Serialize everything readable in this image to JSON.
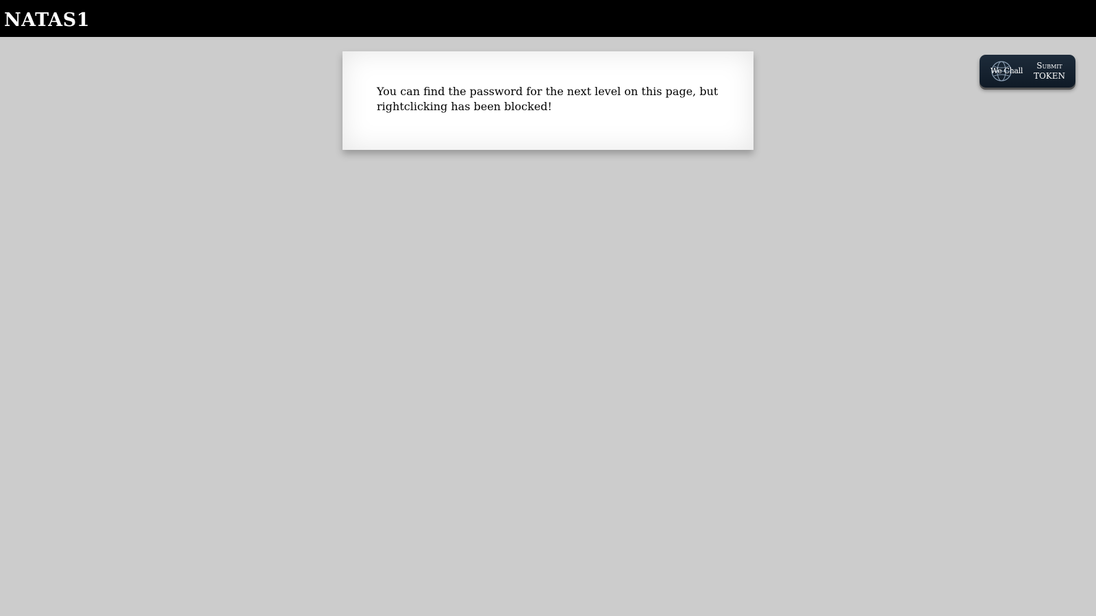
{
  "header": {
    "title": "NATAS1"
  },
  "content": {
    "message": "You can find the password for the next level on this page, but rightclicking has been blocked!"
  },
  "token_button": {
    "brand": "We Chall",
    "line1": "Submit",
    "line2": "TOKEN",
    "icon": "globe-icon"
  },
  "colors": {
    "background": "#cccccc",
    "header": "#000000",
    "button": "#1d2b3a"
  }
}
